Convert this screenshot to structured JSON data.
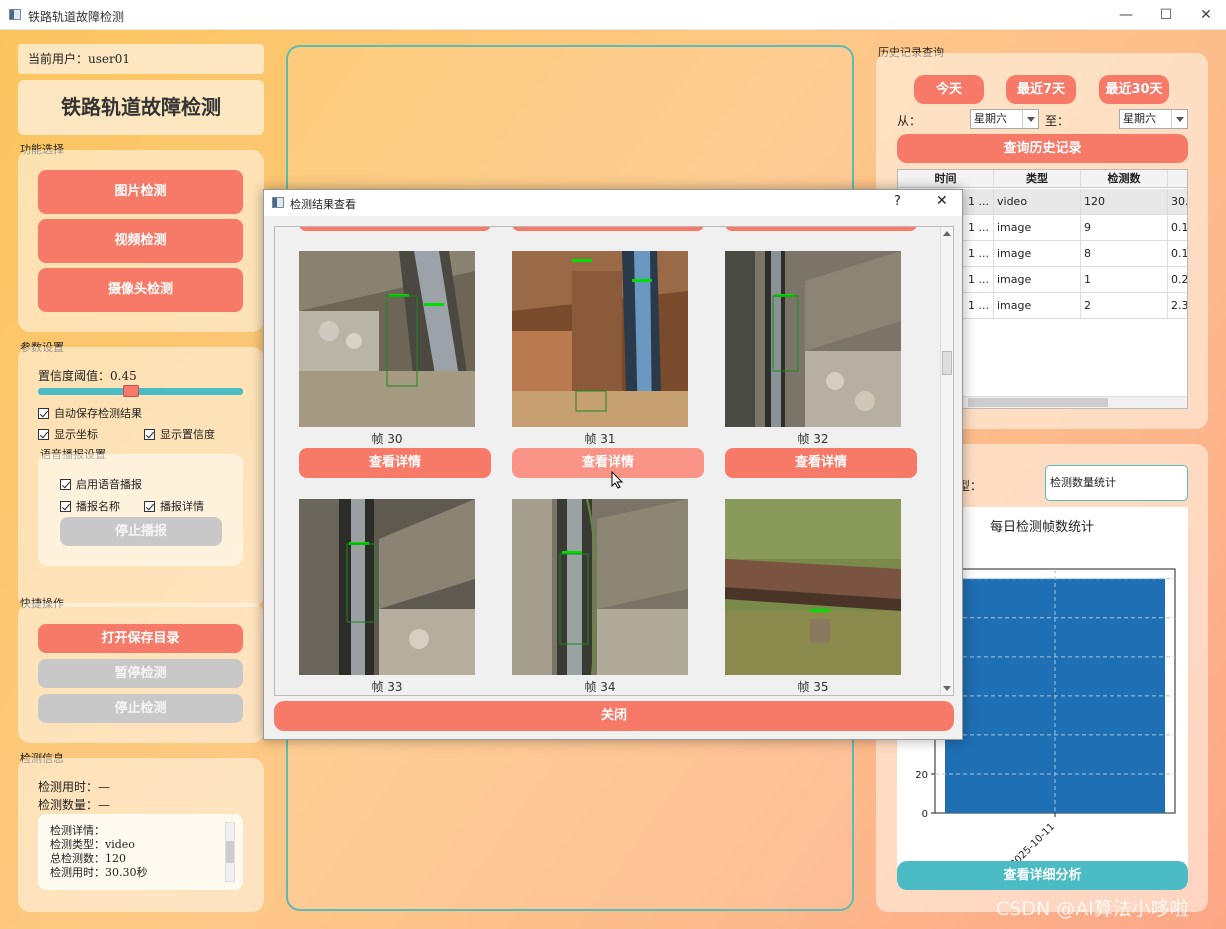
{
  "window": {
    "title": "铁路轨道故障检测",
    "controls": [
      "—",
      "☐",
      "✕"
    ]
  },
  "sidebar": {
    "current_user": "当前用户：user01",
    "app_title": "铁路轨道故障检测",
    "function_section": "功能选择",
    "function_buttons": [
      "图片检测",
      "视频检测",
      "摄像头检测"
    ],
    "params_section": "参数设置",
    "confidence_label": "置信度阈值：0.45",
    "confidence_value": 0.45,
    "auto_save": "自动保存检测结果",
    "show_coords": "显示坐标",
    "show_confidence": "显示置信度",
    "voice_section": "语音播报设置",
    "voice_enable": "启用语音播报",
    "voice_name": "播报名称",
    "voice_detail": "播报详情",
    "voice_stop": "停止播报",
    "quick_section": "快捷操作",
    "quick_buttons": [
      "打开保存目录",
      "暂停检测",
      "停止检测"
    ],
    "info_section": "检测信息",
    "detect_time": "检测用时：—",
    "detect_count": "检测数量：—",
    "detail_lines": [
      "检测详情：",
      "检测类型：video",
      "总检测数：120",
      "检测用时：30.30秒"
    ]
  },
  "history": {
    "section": "历史记录查询",
    "quick_ranges": [
      "今天",
      "最近7天",
      "最近30天"
    ],
    "from_label": "从：",
    "from_value": "星期六",
    "to_label": "至：",
    "to_value": "星期六",
    "query_button": "查询历史记录",
    "columns": [
      "时间",
      "类型",
      "检测数",
      ""
    ],
    "rows": [
      [
        "1 ...",
        "video",
        "120",
        "30."
      ],
      [
        "1 ...",
        "image",
        "9",
        "0.1"
      ],
      [
        "1 ...",
        "image",
        "8",
        "0.1"
      ],
      [
        "1 ...",
        "image",
        "1",
        "0.2"
      ],
      [
        "1 ...",
        "image",
        "2",
        "2.3"
      ]
    ]
  },
  "stats": {
    "type_label": "型：",
    "type_value": "检测数量统计",
    "detail_button": "查看详细分析"
  },
  "chart_data": {
    "type": "bar",
    "title": "每日检测帧数统计",
    "categories": [
      "2025-10-11"
    ],
    "values": [
      120
    ],
    "ylim": [
      0,
      125
    ],
    "y_ticks": [
      "0",
      "20"
    ],
    "xlabel": "",
    "ylabel": "",
    "grid": true,
    "bar_color": "#1f6fb4"
  },
  "dialog": {
    "title": "检测结果查看",
    "help": "?",
    "close_x": "✕",
    "frames": [
      "帧 30",
      "帧 31",
      "帧 32",
      "帧 33",
      "帧 34",
      "帧 35"
    ],
    "detail_button": "查看详情",
    "close_button": "关闭"
  },
  "watermark": "CSDN @AI算法小哆啦"
}
